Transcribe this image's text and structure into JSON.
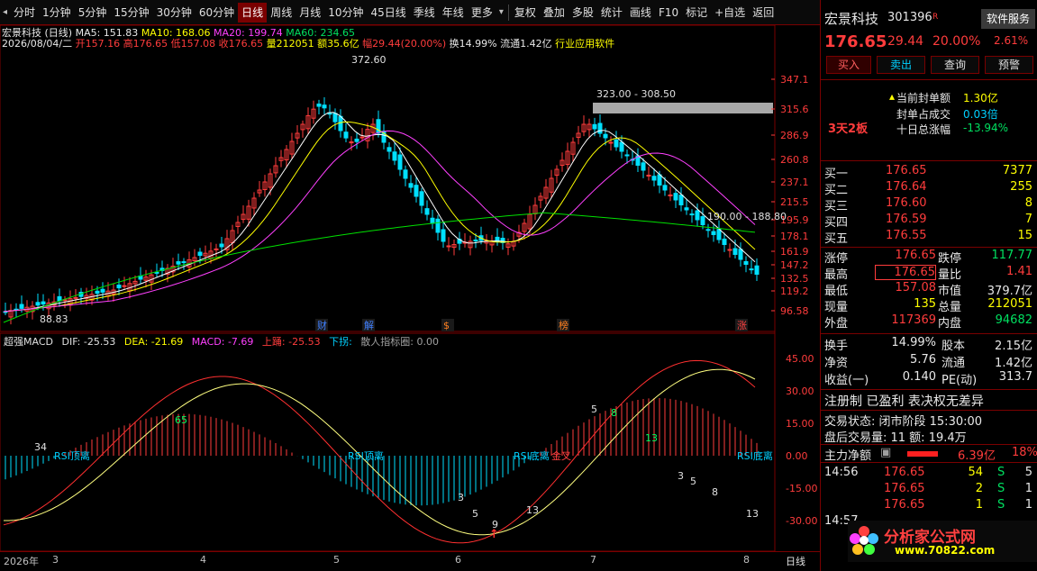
{
  "toolbar": {
    "periods": [
      "分时",
      "1分钟",
      "5分钟",
      "15分钟",
      "30分钟",
      "60分钟",
      "日线",
      "周线",
      "月线",
      "10分钟",
      "45日线",
      "季线",
      "年线",
      "更多"
    ],
    "active_period": "日线",
    "actions": [
      "复权",
      "叠加",
      "多股",
      "统计",
      "画线",
      "F10",
      "标记",
      "+自选",
      "返回"
    ]
  },
  "chart_header": {
    "stock_line": "宏景科技 (日线)",
    "date": "2026/08/04/二",
    "open_label": "开",
    "open": "157.16",
    "high_label": "高",
    "high": "176.65",
    "low_label": "低",
    "low": "157.08",
    "close_label": "收",
    "close": "176.65",
    "vol_label": "量",
    "vol": "212051",
    "amt_label": "额",
    "amt": "35.6亿",
    "chg_label": "幅",
    "chg": "29.44(20.00%)",
    "turnover_label": "换",
    "turnover": "14.99%",
    "float_label": "流通",
    "float": "1.42亿",
    "industry": "行业应用软件"
  },
  "ma_line": {
    "ma5": "MA5: 151.83",
    "ma10": "MA10: 168.06",
    "ma20": "MA20: 199.74",
    "ma60": "MA60: 234.65"
  },
  "price_axis": [
    "347.1",
    "315.6",
    "286.9",
    "260.8",
    "237.1",
    "215.5",
    "195.9",
    "178.1",
    "161.9",
    "147.2",
    "132.5",
    "119.2",
    "96.58"
  ],
  "annotations": {
    "peak1": "372.60",
    "peak2": "323.00 - 308.50",
    "right_range": "190.00 - 188.80",
    "low": "88.83",
    "events": [
      "财",
      "解",
      "$",
      "榜",
      "涨"
    ]
  },
  "macd": {
    "title": "超强MACD",
    "dif": "DIF: -25.53",
    "dea": "DEA: -21.69",
    "macd": "MACD: -7.69",
    "up": "上踊: -25.53",
    "down": "下拐:",
    "extra": "散人指标圈: 0.00",
    "axis": [
      "45.00",
      "30.00",
      "15.00",
      "0.00",
      "-15.00",
      "-30.00"
    ],
    "labels": [
      "34",
      "65",
      "RSI顶离",
      "RSI顶离",
      "RSI底离",
      "金叉",
      "RSI底离",
      "3",
      "5",
      "9",
      "13",
      "5",
      "8",
      "13",
      "3",
      "5",
      "8",
      "13"
    ]
  },
  "xaxis": {
    "year": "2026年",
    "months": [
      "3",
      "4",
      "5",
      "6",
      "7",
      "8"
    ],
    "period": "日线"
  },
  "panel": {
    "name": "宏景科技",
    "code": "301396",
    "badge": "R",
    "service": "软件服务",
    "service_chg": "2.61%",
    "price": "176.65",
    "change": "29.44",
    "pct": "20.00%",
    "buttons": [
      "买入",
      "卖出",
      "查询",
      "预警"
    ],
    "seal_label1": "当前封单额",
    "seal_val1": "1.30亿",
    "seal_label2": "封单占成交",
    "seal_val2": "0.03倍",
    "seal_label3": "十日总涨幅",
    "seal_val3": "-13.94%",
    "board": "3天2板",
    "bids": [
      {
        "label": "买一",
        "price": "176.65",
        "vol": "7377"
      },
      {
        "label": "买二",
        "price": "176.64",
        "vol": "255"
      },
      {
        "label": "买三",
        "price": "176.60",
        "vol": "8"
      },
      {
        "label": "买四",
        "price": "176.59",
        "vol": "7"
      },
      {
        "label": "买五",
        "price": "176.55",
        "vol": "15"
      }
    ],
    "stats": [
      {
        "l1": "涨停",
        "v1": "176.65",
        "l2": "跌停",
        "v2": "117.77"
      },
      {
        "l1": "最高",
        "v1": "176.65",
        "l2": "量比",
        "v2": "1.41"
      },
      {
        "l1": "最低",
        "v1": "157.08",
        "l2": "市值",
        "v2": "379.7亿"
      },
      {
        "l1": "现量",
        "v1": "135",
        "l2": "总量",
        "v2": "212051"
      },
      {
        "l1": "外盘",
        "v1": "117369",
        "l2": "内盘",
        "v2": "94682"
      }
    ],
    "fin": [
      {
        "l1": "换手",
        "v1": "14.99%",
        "l2": "股本",
        "v2": "2.15亿"
      },
      {
        "l1": "净资",
        "v1": "5.76",
        "l2": "流通",
        "v2": "1.42亿"
      },
      {
        "l1": "收益(一)",
        "v1": "0.140",
        "l2": "PE(动)",
        "v2": "313.7"
      }
    ],
    "reg": "注册制 已盈利 表决权无差异",
    "trade_status": "交易状态: 闭市阶段 15:30:00",
    "after": "盘后交易量: 11  额: 19.4万",
    "main_flow_label": "主力净额",
    "main_flow": "6.39亿",
    "main_pct": "18%",
    "ticks": [
      {
        "t": "14:56",
        "p": "176.65",
        "v": "54",
        "s": "S",
        "n": "5"
      },
      {
        "t": "",
        "p": "176.65",
        "v": "2",
        "s": "S",
        "n": "1"
      },
      {
        "t": "",
        "p": "176.65",
        "v": "1",
        "s": "S",
        "n": "1"
      },
      {
        "t": "14:57",
        "p": "",
        "v": "",
        "s": "",
        "n": ""
      }
    ],
    "watermark": "分析家公式网",
    "watermark_url": "www.70822.com"
  },
  "colors": {
    "up": "#ff3c3c",
    "down": "#00e0ff",
    "ma5": "#ffffff",
    "ma10": "#ffff00",
    "ma20": "#ff40ff",
    "ma60": "#00e000"
  }
}
